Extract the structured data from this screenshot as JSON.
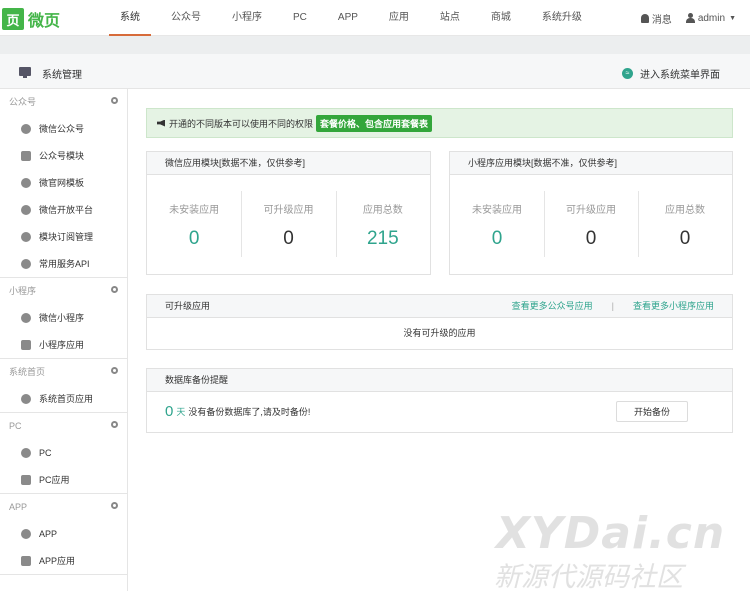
{
  "logo": {
    "mark": "页",
    "text": "微页"
  },
  "nav": {
    "tabs": [
      "系统",
      "公众号",
      "小程序",
      "PC",
      "APP",
      "应用",
      "站点",
      "商城",
      "系统升级"
    ],
    "active_index": 0,
    "messages_label": "消息",
    "user_label": "admin"
  },
  "subheader": {
    "title": "系统管理",
    "enter_menu": "进入系统菜单界面"
  },
  "sidebar": {
    "groups": [
      {
        "title": "公众号",
        "items": [
          "微信公众号",
          "公众号模块",
          "微官网模板",
          "微信开放平台",
          "模块订阅管理",
          "常用服务API"
        ]
      },
      {
        "title": "小程序",
        "items": [
          "微信小程序",
          "小程序应用"
        ]
      },
      {
        "title": "系统首页",
        "items": [
          "系统首页应用"
        ]
      },
      {
        "title": "PC",
        "items": [
          "PC",
          "PC应用"
        ]
      },
      {
        "title": "APP",
        "items": [
          "APP",
          "APP应用"
        ]
      }
    ]
  },
  "notice": {
    "text": "开通的不同版本可以使用不同的权限",
    "highlight": "套餐价格、包含应用套餐表"
  },
  "wechat_card": {
    "title": "微信应用模块[数据不准，仅供参考]",
    "stats": [
      {
        "label": "未安装应用",
        "value": "0"
      },
      {
        "label": "可升级应用",
        "value": "0"
      },
      {
        "label": "应用总数",
        "value": "215"
      }
    ]
  },
  "mini_card": {
    "title": "小程序应用模块[数据不准，仅供参考]",
    "stats": [
      {
        "label": "未安装应用",
        "value": "0"
      },
      {
        "label": "可升级应用",
        "value": "0"
      },
      {
        "label": "应用总数",
        "value": "0"
      }
    ]
  },
  "upgrade_card": {
    "title": "可升级应用",
    "link_wechat": "查看更多公众号应用",
    "separator": "|",
    "link_mini": "查看更多小程序应用",
    "empty_text": "没有可升级的应用"
  },
  "backup_card": {
    "title": "数据库备份提醒",
    "days": "0",
    "unit": "天",
    "text": "没有备份数据库了,请及时备份!",
    "button": "开始备份"
  },
  "watermark": {
    "line1": "XYDai.cn",
    "line2": "新源代源码社区"
  },
  "colors": {
    "brand_green": "#44b549",
    "teal": "#2fa48d",
    "active_tab_underline": "#d76b3a"
  }
}
